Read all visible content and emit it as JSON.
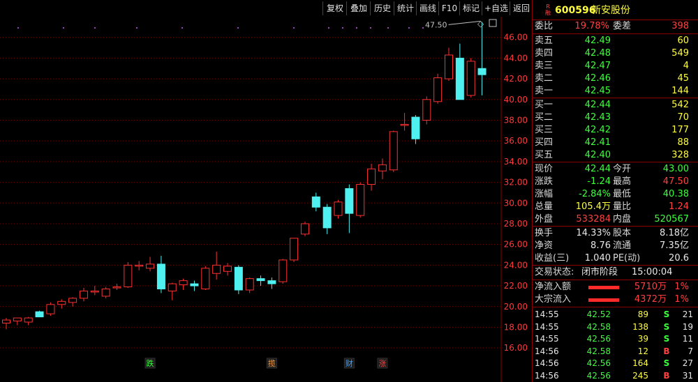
{
  "toolbar": {
    "buttons": [
      "复权",
      "叠加",
      "历史",
      "统计",
      "画线",
      "F10",
      "标记",
      "+自选",
      "返回"
    ]
  },
  "stock": {
    "badge_top": "R",
    "badge_bottom": "融",
    "code": "600596",
    "name": "新安股份"
  },
  "weibi": {
    "label": "委比",
    "value": "19.78%",
    "diff_label": "委差",
    "diff_value": "398"
  },
  "asks": [
    {
      "label": "卖五",
      "price": "42.49",
      "vol": "60"
    },
    {
      "label": "卖四",
      "price": "42.48",
      "vol": "549"
    },
    {
      "label": "卖三",
      "price": "42.47",
      "vol": "4"
    },
    {
      "label": "卖二",
      "price": "42.46",
      "vol": "45"
    },
    {
      "label": "卖一",
      "price": "42.45",
      "vol": "144"
    }
  ],
  "bids": [
    {
      "label": "买一",
      "price": "42.44",
      "vol": "542"
    },
    {
      "label": "买二",
      "price": "42.43",
      "vol": "70"
    },
    {
      "label": "买三",
      "price": "42.42",
      "vol": "177"
    },
    {
      "label": "买四",
      "price": "42.41",
      "vol": "88"
    },
    {
      "label": "买五",
      "price": "42.40",
      "vol": "328"
    }
  ],
  "quote": [
    {
      "l1": "现价",
      "v1": "42.44",
      "c1": "green",
      "l2": "今开",
      "v2": "43.00",
      "c2": "green"
    },
    {
      "l1": "涨跌",
      "v1": "-1.24",
      "c1": "green",
      "l2": "最高",
      "v2": "47.50",
      "c2": "red"
    },
    {
      "l1": "涨幅",
      "v1": "-2.84%",
      "c1": "green",
      "l2": "最低",
      "v2": "40.38",
      "c2": "green"
    },
    {
      "l1": "总量",
      "v1": "105.4万",
      "c1": "yellow",
      "l2": "量比",
      "v2": "1.24",
      "c2": "red"
    },
    {
      "l1": "外盘",
      "v1": "533284",
      "c1": "red",
      "l2": "内盘",
      "v2": "520567",
      "c2": "green"
    }
  ],
  "fund": [
    {
      "l1": "换手",
      "v1": "14.33%",
      "l2": "股本",
      "v2": "8.18亿"
    },
    {
      "l1": "净资",
      "v1": "8.76",
      "l2": "流通",
      "v2": "7.35亿"
    },
    {
      "l1": "收益(三)",
      "v1": "1.040",
      "l2": "PE(动)",
      "v2": "20.6"
    }
  ],
  "status": {
    "label": "交易状态:",
    "value": "闭市阶段",
    "time": "15:00:04"
  },
  "flows": [
    {
      "label": "净流入额",
      "amount": "5710万",
      "pct": "1%"
    },
    {
      "label": "大宗流入",
      "amount": "4372万",
      "pct": "1%"
    }
  ],
  "ticks": [
    {
      "time": "14:55",
      "price": "42.52",
      "vol": "89",
      "dir": "S",
      "n": "21"
    },
    {
      "time": "14:55",
      "price": "42.58",
      "vol": "138",
      "dir": "S",
      "n": "19"
    },
    {
      "time": "14:55",
      "price": "42.56",
      "vol": "39",
      "dir": "S",
      "n": "11"
    },
    {
      "time": "14:56",
      "price": "42.58",
      "vol": "12",
      "dir": "B",
      "n": "7"
    },
    {
      "time": "14:56",
      "price": "42.56",
      "vol": "164",
      "dir": "S",
      "n": "27"
    },
    {
      "time": "14:56",
      "price": "42.56",
      "vol": "245",
      "dir": "B",
      "n": "31"
    }
  ],
  "colors": {
    "up": "#ff3030",
    "down": "#4ff0f0",
    "grid": "#7a0000",
    "axis_text": "#ff3b3b",
    "bg": "#000000"
  },
  "chart_data": {
    "type": "candlestick",
    "title": "",
    "y_ticks": [
      16.0,
      18.0,
      20.0,
      22.0,
      24.0,
      26.0,
      28.0,
      30.0,
      32.0,
      34.0,
      36.0,
      38.0,
      40.0,
      42.0,
      44.0,
      46.0
    ],
    "ylim": [
      15.0,
      48.0
    ],
    "max_label": "47.50",
    "markers": [
      {
        "text": "跌",
        "index": 13,
        "color": "#3dff3d"
      },
      {
        "text": "揽",
        "index": 24,
        "color": "#ffa040"
      },
      {
        "text": "财",
        "index": 31,
        "color": "#40a0ff"
      },
      {
        "text": "涨",
        "index": 34,
        "color": "#ff4040"
      }
    ],
    "candles": [
      {
        "o": 18.4,
        "h": 18.9,
        "l": 17.8,
        "c": 18.7
      },
      {
        "o": 18.6,
        "h": 18.9,
        "l": 18.2,
        "c": 18.9
      },
      {
        "o": 18.5,
        "h": 19.0,
        "l": 18.2,
        "c": 18.9
      },
      {
        "o": 19.5,
        "h": 19.6,
        "l": 19.1,
        "c": 19.0
      },
      {
        "o": 19.3,
        "h": 20.4,
        "l": 19.1,
        "c": 20.2
      },
      {
        "o": 20.2,
        "h": 20.7,
        "l": 19.8,
        "c": 20.5
      },
      {
        "o": 20.4,
        "h": 20.9,
        "l": 20.0,
        "c": 20.8
      },
      {
        "o": 20.8,
        "h": 21.8,
        "l": 20.5,
        "c": 21.5
      },
      {
        "o": 21.4,
        "h": 22.0,
        "l": 21.1,
        "c": 21.5
      },
      {
        "o": 21.0,
        "h": 21.9,
        "l": 20.8,
        "c": 21.7
      },
      {
        "o": 21.8,
        "h": 22.2,
        "l": 21.6,
        "c": 21.9
      },
      {
        "o": 21.9,
        "h": 24.3,
        "l": 21.8,
        "c": 24.0
      },
      {
        "o": 24.0,
        "h": 24.4,
        "l": 23.5,
        "c": 24.0
      },
      {
        "o": 23.7,
        "h": 24.8,
        "l": 23.4,
        "c": 24.1
      },
      {
        "o": 24.1,
        "h": 24.9,
        "l": 21.3,
        "c": 21.7
      },
      {
        "o": 21.5,
        "h": 22.3,
        "l": 20.6,
        "c": 22.2
      },
      {
        "o": 22.1,
        "h": 22.7,
        "l": 21.6,
        "c": 22.5
      },
      {
        "o": 22.2,
        "h": 22.5,
        "l": 21.5,
        "c": 22.0
      },
      {
        "o": 21.7,
        "h": 23.9,
        "l": 21.6,
        "c": 23.7
      },
      {
        "o": 23.2,
        "h": 25.3,
        "l": 22.6,
        "c": 24.0
      },
      {
        "o": 23.4,
        "h": 24.2,
        "l": 23.0,
        "c": 23.9
      },
      {
        "o": 23.8,
        "h": 24.0,
        "l": 21.2,
        "c": 21.6
      },
      {
        "o": 21.6,
        "h": 22.8,
        "l": 21.3,
        "c": 22.7
      },
      {
        "o": 22.7,
        "h": 23.0,
        "l": 22.0,
        "c": 22.5
      },
      {
        "o": 22.5,
        "h": 22.8,
        "l": 21.7,
        "c": 22.2
      },
      {
        "o": 22.4,
        "h": 24.6,
        "l": 22.2,
        "c": 24.5
      },
      {
        "o": 24.5,
        "h": 26.6,
        "l": 24.3,
        "c": 26.6
      },
      {
        "o": 27.0,
        "h": 28.2,
        "l": 26.8,
        "c": 28.0
      },
      {
        "o": 30.6,
        "h": 31.0,
        "l": 29.2,
        "c": 29.6
      },
      {
        "o": 29.6,
        "h": 29.9,
        "l": 27.0,
        "c": 27.6
      },
      {
        "o": 28.8,
        "h": 30.3,
        "l": 28.5,
        "c": 30.1
      },
      {
        "o": 31.4,
        "h": 31.8,
        "l": 27.1,
        "c": 29.0
      },
      {
        "o": 28.8,
        "h": 32.0,
        "l": 28.6,
        "c": 31.8
      },
      {
        "o": 31.8,
        "h": 33.8,
        "l": 31.2,
        "c": 33.3
      },
      {
        "o": 33.1,
        "h": 34.3,
        "l": 32.3,
        "c": 33.7
      },
      {
        "o": 33.2,
        "h": 37.0,
        "l": 33.0,
        "c": 36.9
      },
      {
        "o": 37.5,
        "h": 38.7,
        "l": 37.0,
        "c": 37.6
      },
      {
        "o": 38.3,
        "h": 38.5,
        "l": 35.7,
        "c": 36.2
      },
      {
        "o": 38.0,
        "h": 40.3,
        "l": 37.6,
        "c": 40.0
      },
      {
        "o": 39.8,
        "h": 42.5,
        "l": 39.6,
        "c": 42.1
      },
      {
        "o": 42.0,
        "h": 45.0,
        "l": 41.8,
        "c": 44.3
      },
      {
        "o": 44.0,
        "h": 45.4,
        "l": 40.0,
        "c": 40.0
      },
      {
        "o": 40.4,
        "h": 44.0,
        "l": 40.2,
        "c": 43.7
      },
      {
        "o": 43.0,
        "h": 47.5,
        "l": 40.4,
        "c": 42.4
      }
    ]
  }
}
